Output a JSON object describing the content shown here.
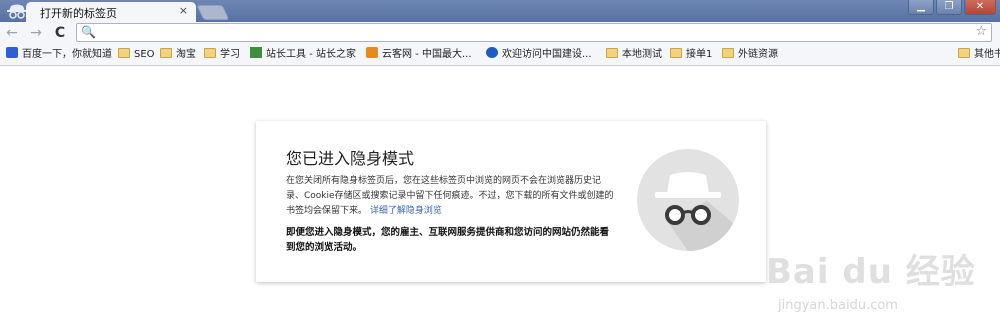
{
  "tab": {
    "title": "打开新的标签页",
    "close_glyph": "×"
  },
  "window": {
    "minimize": "▁",
    "restore": "❐",
    "close": "✕"
  },
  "toolbar": {
    "back_icon": "arrow-left-icon",
    "back_glyph": "←",
    "forward_icon": "arrow-right-icon",
    "forward_glyph": "→",
    "reload_icon": "reload-icon",
    "reload_glyph": "C",
    "search_glyph": "🔍",
    "star_glyph": "☆",
    "omnibox_value": ""
  },
  "bookmarks": [
    {
      "label": "百度一下，你就知道",
      "icon": "baidu-icon"
    },
    {
      "label": "SEO",
      "icon": "folder-icon"
    },
    {
      "label": "淘宝",
      "icon": "folder-icon"
    },
    {
      "label": "学习",
      "icon": "folder-icon"
    },
    {
      "label": "站长工具 - 站长之家",
      "icon": "chart-icon"
    },
    {
      "label": "云客网 - 中国最大...",
      "icon": "cloud-icon"
    },
    {
      "label": "欢迎访问中国建设...",
      "icon": "ccb-icon"
    },
    {
      "label": "本地测试",
      "icon": "folder-icon"
    },
    {
      "label": "接单1",
      "icon": "folder-icon"
    },
    {
      "label": "外链资源",
      "icon": "folder-icon"
    },
    {
      "label": "其他书",
      "icon": "folder-icon"
    }
  ],
  "incognito": {
    "title": "您已进入隐身模式",
    "p1_a": "在您关闭所有隐身标签页后，您在这些标签页中浏览的网页不会在浏览器历史记录、Cookie存储区或搜索记录中留下任何痕迹。不过，您下载的所有文件或创建的书签均会保留下来。",
    "learn_more": "详细了解隐身浏览",
    "p2": "即便您进入隐身模式，您的雇主、互联网服务提供商和您访问的网站仍然能看到您的浏览活动。"
  },
  "watermark": {
    "brand": "Bai du 经验",
    "url": "jingyan.baidu.com"
  },
  "colors": {
    "titlebar": "#5f78a8",
    "link": "#3b66b4",
    "card_shadow": "#bbbbbb"
  }
}
